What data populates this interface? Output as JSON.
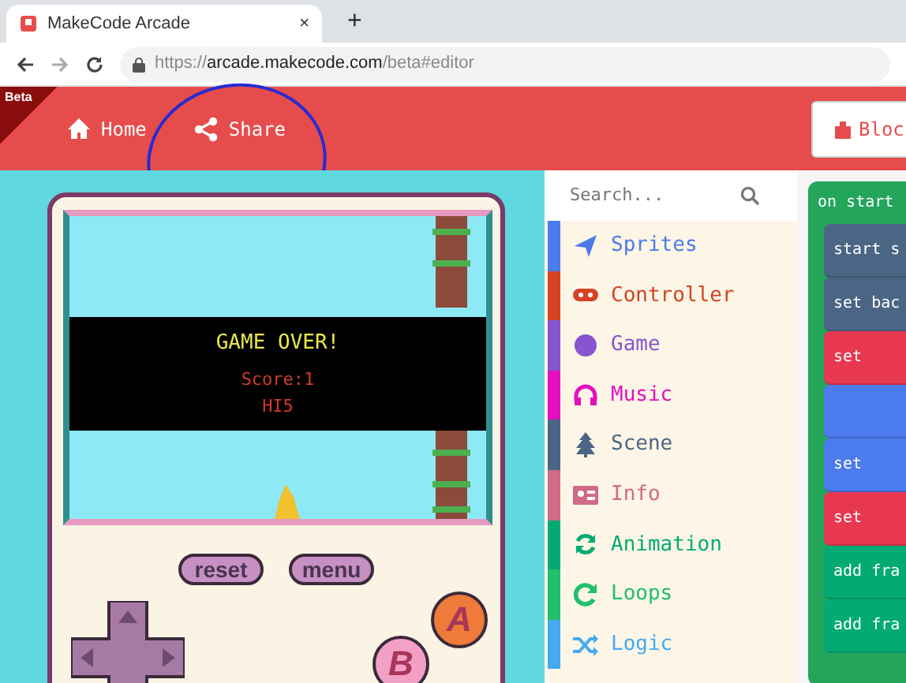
{
  "browser": {
    "tab": {
      "title": "MakeCode Arcade",
      "close": "×",
      "selected": true
    },
    "new_tab": "+",
    "url": {
      "scheme": "https://",
      "host": "arcade.makecode.com",
      "path": "/beta#editor"
    }
  },
  "header": {
    "badge": "Beta",
    "nav": [
      {
        "label": "Home"
      },
      {
        "label": "Share"
      }
    ],
    "editor_toggle": "Bloc"
  },
  "simulator": {
    "game_over": "GAME OVER!",
    "score": "Score:1",
    "high_score": "HI5",
    "buttons": [
      "reset",
      "menu"
    ],
    "a_button": "A",
    "b_button": "B"
  },
  "toolbox": {
    "search": {
      "placeholder": "Search..."
    },
    "categories": [
      {
        "name": "Sprites",
        "color": "#4b7bec"
      },
      {
        "name": "Controller",
        "color": "#d54322"
      },
      {
        "name": "Game",
        "color": "#8854d0"
      },
      {
        "name": "Music",
        "color": "#e30fc0"
      },
      {
        "name": "Scene",
        "color": "#4b6584"
      },
      {
        "name": "Info",
        "color": "#cf6a87"
      },
      {
        "name": "Animation",
        "color": "#03aa74"
      },
      {
        "name": "Loops",
        "color": "#20bf6b"
      },
      {
        "name": "Logic",
        "color": "#45aaf2"
      }
    ]
  },
  "workspace": {
    "event": {
      "label": "on start",
      "color": "#23a55a"
    },
    "blocks": [
      {
        "label": "start s",
        "color": "#4b6584"
      },
      {
        "label": "set bac",
        "color": "#4b6584"
      },
      {
        "label": "set",
        "color": "#e8384f"
      },
      {
        "color": "#4b7bec"
      },
      {
        "label": "set",
        "color": "#4b7bec"
      },
      {
        "label": "set",
        "color": "#e8384f"
      },
      {
        "label": "add fra",
        "color": "#03aa74"
      },
      {
        "label": "add fra",
        "color": "#03aa74"
      }
    ]
  }
}
